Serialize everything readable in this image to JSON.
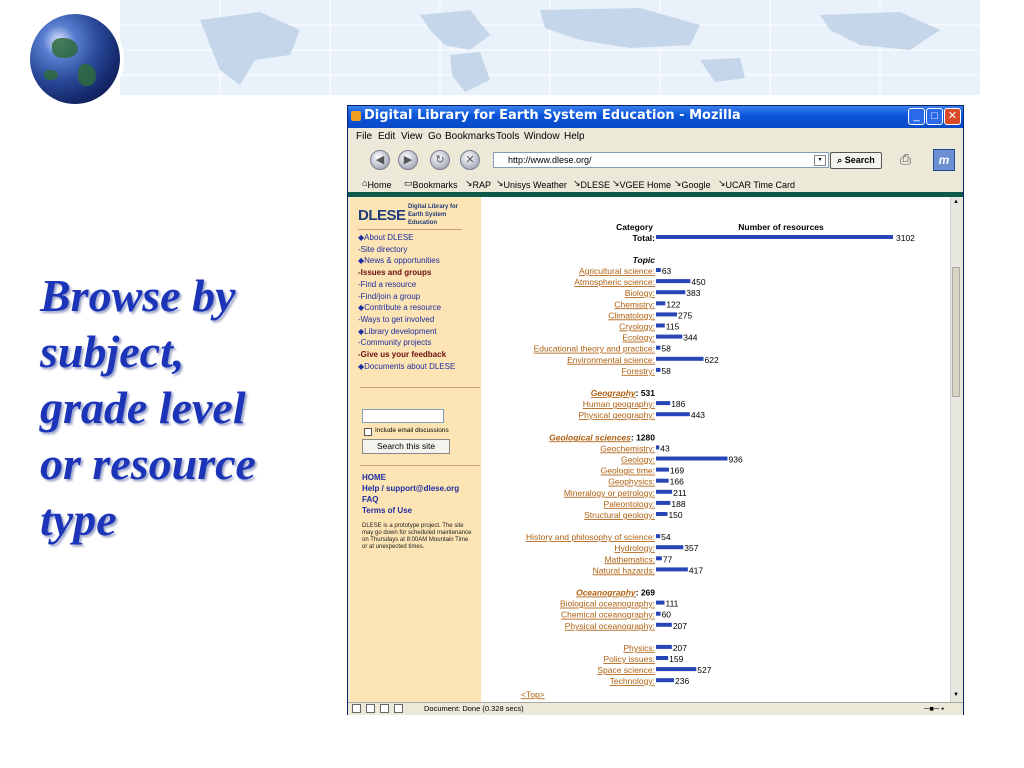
{
  "slide": {
    "title_lines": [
      "Browse by",
      "subject,",
      "grade level",
      "or resource",
      "type"
    ]
  },
  "window": {
    "title": "Digital Library for Earth System Education - Mozilla",
    "controls": {
      "minimize": "_",
      "maximize": "□",
      "close": "✕"
    }
  },
  "menu": [
    "File",
    "Edit",
    "View",
    "Go",
    "Bookmarks",
    "Tools",
    "Window",
    "Help"
  ],
  "nav": {
    "url": "http://www.dlese.org/",
    "search_label": "Search"
  },
  "bookmarks": [
    "Home",
    "Bookmarks",
    "RAP",
    "Unisys Weather",
    "DLESE",
    "VGEE Home",
    "Google",
    "UCAR Time Card"
  ],
  "sidebar": {
    "logo_text": "DLESE",
    "logo_sub": "Digital Library for Earth System Education",
    "links": [
      {
        "label": "About DLESE",
        "style": "bullet"
      },
      {
        "label": "Site directory",
        "style": "dash"
      },
      {
        "label": "News & opportunities",
        "style": "bullet"
      },
      {
        "label": "Issues and groups",
        "style": "dark"
      },
      {
        "label": "Find a resource",
        "style": "dash"
      },
      {
        "label": "Find/join a group",
        "style": "dash"
      },
      {
        "label": "Contribute a resource",
        "style": "bullet"
      },
      {
        "label": "Ways to get involved",
        "style": "dash"
      },
      {
        "label": "Library development",
        "style": "bullet"
      },
      {
        "label": "Community projects",
        "style": "dash"
      },
      {
        "label": "Give us your feedback",
        "style": "dark"
      },
      {
        "label": "Documents about DLESE",
        "style": "bullet"
      }
    ],
    "search_checkbox_label": "Include email discussions",
    "search_button": "Search this site",
    "footer_links": [
      "HOME",
      "Help / support@dlese.org",
      "FAQ",
      "Terms of Use"
    ],
    "note": "DLESE is a prototype project. The site may go down for scheduled maintenance on Thursdays at 8:00AM Mountain Time or at unexpected times."
  },
  "status_text": "Document: Done (0.328 secs)",
  "chart_data": {
    "type": "bar",
    "header_category": "Category",
    "header_count": "Number of resources",
    "total": {
      "label": "Total:",
      "value": 3102
    },
    "topic_heading": "Topic",
    "scale_max": 3102,
    "groups": [
      {
        "heading": null,
        "items": [
          {
            "label": "Agricultural science:",
            "value": 63
          },
          {
            "label": "Atmospheric science:",
            "value": 450
          },
          {
            "label": "Biology:",
            "value": 383
          },
          {
            "label": "Chemistry:",
            "value": 122
          },
          {
            "label": "Climatology:",
            "value": 275
          },
          {
            "label": "Cryology:",
            "value": 115
          },
          {
            "label": "Ecology:",
            "value": 344
          },
          {
            "label": "Educational theory and practice:",
            "value": 58
          },
          {
            "label": "Environmental science:",
            "value": 622
          },
          {
            "label": "Forestry:",
            "value": 58
          }
        ]
      },
      {
        "heading": {
          "label": "Geography",
          "value": 531
        },
        "items": [
          {
            "label": "Human geography:",
            "value": 186
          },
          {
            "label": "Physical geography:",
            "value": 443
          }
        ]
      },
      {
        "heading": {
          "label": "Geological sciences",
          "value": 1280
        },
        "items": [
          {
            "label": "Geochemistry:",
            "value": 43
          },
          {
            "label": "Geology:",
            "value": 936
          },
          {
            "label": "Geologic time:",
            "value": 169
          },
          {
            "label": "Geophysics:",
            "value": 166
          },
          {
            "label": "Mineralogy or petrology:",
            "value": 211
          },
          {
            "label": "Paleontology:",
            "value": 188
          },
          {
            "label": "Structural geology:",
            "value": 150
          }
        ]
      },
      {
        "heading": null,
        "items": [
          {
            "label": "History and philosophy of science:",
            "value": 54
          },
          {
            "label": "Hydrology:",
            "value": 357
          },
          {
            "label": "Mathematics:",
            "value": 77
          },
          {
            "label": "Natural hazards:",
            "value": 417
          }
        ]
      },
      {
        "heading": {
          "label": "Oceanography",
          "value": 269
        },
        "items": [
          {
            "label": "Biological oceanography:",
            "value": 111
          },
          {
            "label": "Chemical oceanography:",
            "value": 60
          },
          {
            "label": "Physical oceanography:",
            "value": 207
          }
        ]
      },
      {
        "heading": null,
        "items": [
          {
            "label": "Physics:",
            "value": 207
          },
          {
            "label": "Policy issues:",
            "value": 159
          },
          {
            "label": "Space science:",
            "value": 527
          },
          {
            "label": "Technology:",
            "value": 236
          }
        ]
      }
    ],
    "top_link": "<Top>",
    "colors": {
      "bar": "#2846b8",
      "link": "#b06010",
      "heading": "#000000"
    }
  }
}
